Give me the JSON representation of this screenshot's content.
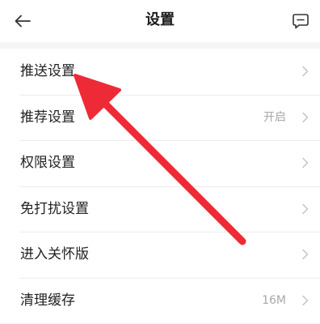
{
  "header": {
    "title": "设置",
    "back_icon": "arrow-left-icon",
    "feedback_icon": "message-square-icon"
  },
  "settings": [
    {
      "label": "推送设置",
      "value": ""
    },
    {
      "label": "推荐设置",
      "value": "开启"
    },
    {
      "label": "权限设置",
      "value": ""
    },
    {
      "label": "免打扰设置",
      "value": ""
    },
    {
      "label": "进入关怀版",
      "value": ""
    },
    {
      "label": "清理缓存",
      "value": "16M"
    }
  ],
  "colors": {
    "annotation_arrow": "#ee2a36",
    "page_background": "#f5f5f5",
    "secondary_text": "#a8a8a8"
  }
}
